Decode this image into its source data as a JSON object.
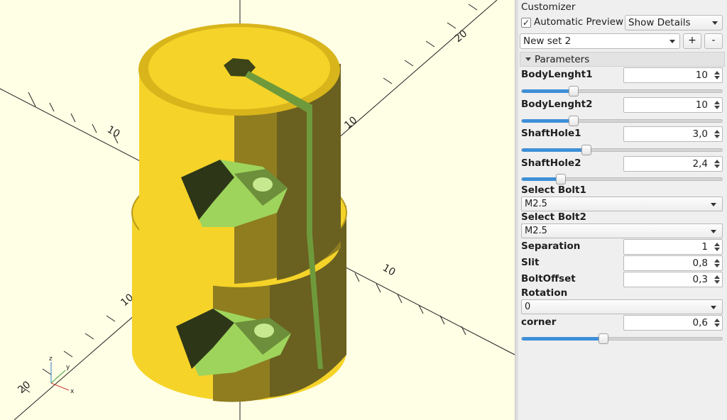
{
  "viewport": {
    "axis_tick_labels": [
      "20",
      "10",
      "10",
      "10",
      "10",
      "20"
    ],
    "small_axes": {
      "x": "x",
      "y": "y",
      "z": "z"
    },
    "colors": {
      "background": "#ffffe5",
      "part_yellow": "#f5d328",
      "part_dark": "#4a4620",
      "hole_green": "#9ed45c",
      "slit_green": "#6f9a3c"
    }
  },
  "customizer": {
    "title": "Customizer",
    "automatic_preview_label": "Automatic Preview",
    "automatic_preview_checked": "✓",
    "details_select": "Show Details",
    "preset_select": "New set 2",
    "add_button": "+",
    "remove_button": "-",
    "parameters_header": "Parameters",
    "params": {
      "body1_label": "BodyLenght1",
      "body1_value": "10",
      "body1_fraction": 0.25,
      "body2_label": "BodyLenght2",
      "body2_value": "10",
      "body2_fraction": 0.25,
      "shaft1_label": "ShaftHole1",
      "shaft1_value": "3,0",
      "shaft1_fraction": 0.32,
      "shaft2_label": "ShaftHole2",
      "shaft2_value": "2,4",
      "shaft2_fraction": 0.19,
      "bolt1_label": "Select Bolt1",
      "bolt1_value": "M2.5",
      "bolt2_label": "Select Bolt2",
      "bolt2_value": "M2.5",
      "separation_label": "Separation",
      "separation_value": "1",
      "slit_label": "Slit",
      "slit_value": "0,8",
      "boltoffset_label": "BoltOffset",
      "boltoffset_value": "0,3",
      "rotation_label": "Rotation",
      "rotation_value": "0",
      "corner_label": "corner",
      "corner_value": "0,6",
      "corner_fraction": 0.4
    }
  }
}
